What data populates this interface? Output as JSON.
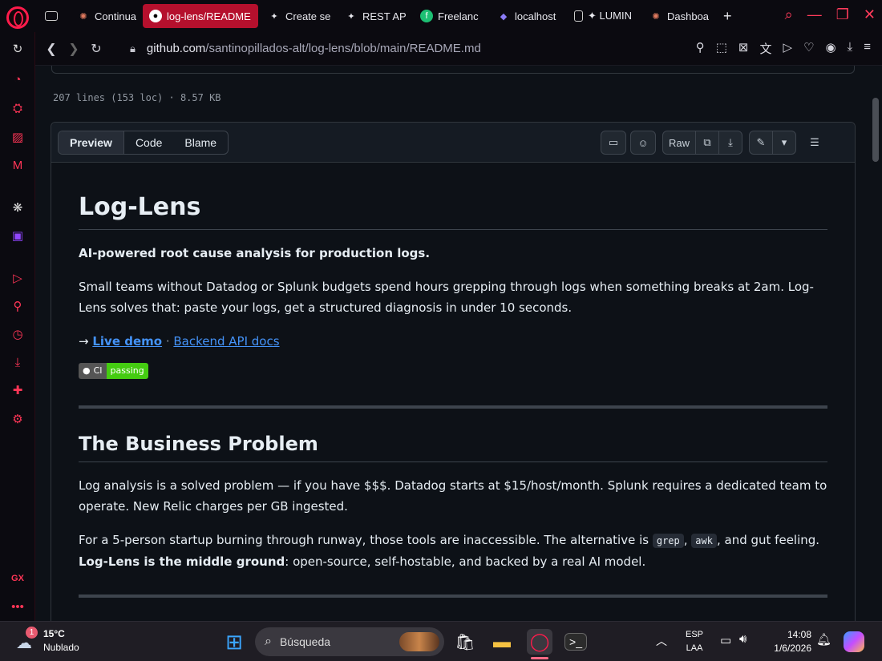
{
  "tabs": [
    {
      "label": "",
      "icon": "gamepad-icon"
    },
    {
      "label": "Continua",
      "icon": "claude-icon"
    },
    {
      "label": "log-lens/README",
      "icon": "github-icon",
      "active": true
    },
    {
      "label": "Create se",
      "icon": "sparkle-icon"
    },
    {
      "label": "REST AP",
      "icon": "sparkle-icon"
    },
    {
      "label": "Freelanc",
      "icon": "fiverr-icon"
    },
    {
      "label": "localhost",
      "icon": "stack-icon"
    },
    {
      "label": "✦ LUMIN",
      "icon": "document-icon"
    },
    {
      "label": "Dashboa",
      "icon": "claude-icon"
    }
  ],
  "address": {
    "host": "github.com",
    "path": "/santinopillados-alt/log-lens/blob/main/README.md"
  },
  "file": {
    "info": "207 lines (153 loc) · 8.57 KB"
  },
  "view_tabs": {
    "preview": "Preview",
    "code": "Code",
    "blame": "Blame"
  },
  "toolbar": {
    "raw": "Raw"
  },
  "readme": {
    "title": "Log-Lens",
    "tagline": "AI-powered root cause analysis for production logs.",
    "intro": "Small teams without Datadog or Splunk budgets spend hours grepping through logs when something breaks at 2am. Log-Lens solves that: paste your logs, get a structured diagnosis in under 10 seconds.",
    "arrow": "→ ",
    "live_demo": "Live demo",
    "sep": " · ",
    "api_docs": "Backend API docs",
    "badge_left": "CI",
    "badge_right": "passing",
    "h2": "The Business Problem",
    "p1": "Log analysis is a solved problem — if you have $$$. Datadog starts at $15/host/month. Splunk requires a dedicated team to operate. New Relic charges per GB ingested.",
    "p2_a": "For a 5-person startup burning through runway, those tools are inaccessible. The alternative is ",
    "code1": "grep",
    "p2_b": ", ",
    "code2": "awk",
    "p2_c": ", and gut feeling.",
    "p3_strong": "Log-Lens is the middle ground",
    "p3_rest": ": open-source, self-hostable, and backed by a real AI model."
  },
  "taskbar": {
    "temp": "15°C",
    "weather": "Nublado",
    "weather_badge": "1",
    "search": "Búsqueda",
    "lang1": "ESP",
    "lang2": "LAA",
    "time": "14:08",
    "date": "1/6/2026"
  },
  "colors": {
    "accent": "#ff1b4b",
    "link": "#4493f8",
    "badge_green": "#44cc11"
  }
}
